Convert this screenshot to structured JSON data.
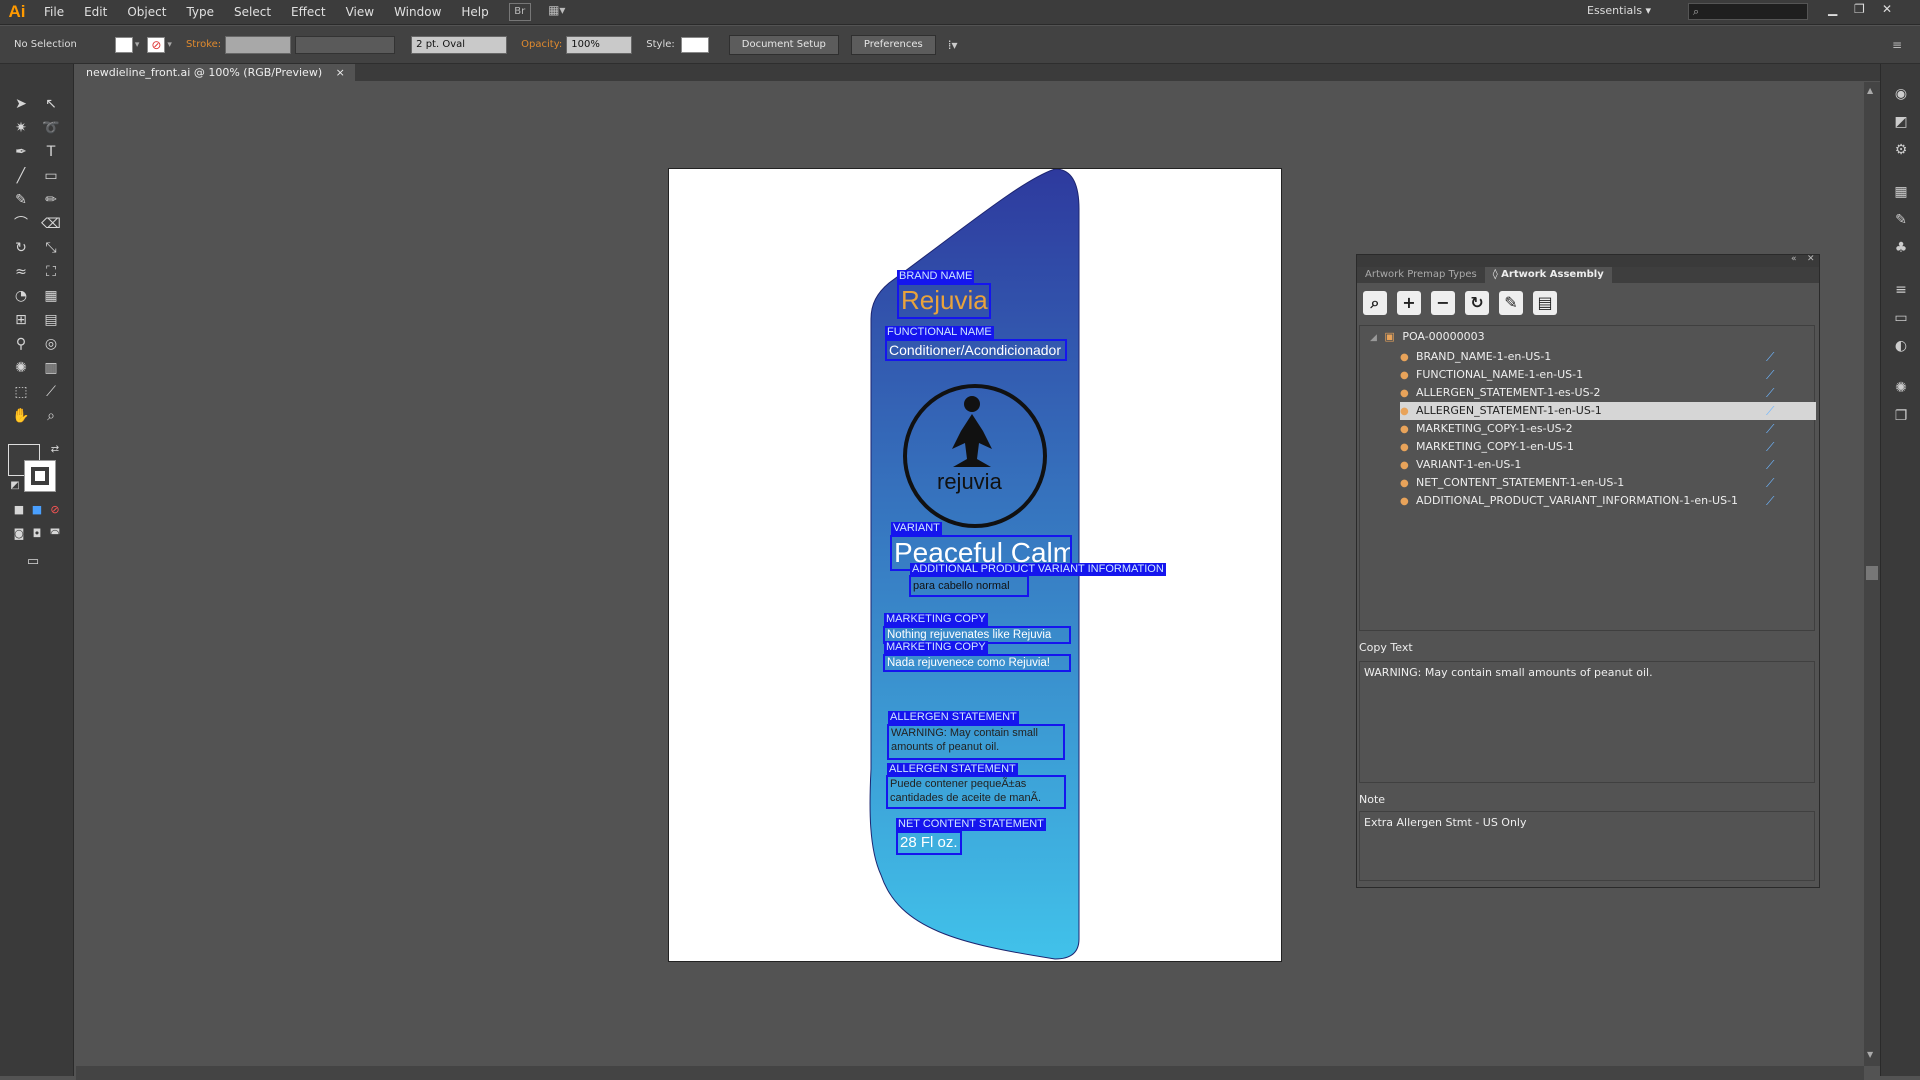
{
  "app": {
    "logo": "Ai"
  },
  "menu": [
    "File",
    "Edit",
    "Object",
    "Type",
    "Select",
    "Effect",
    "View",
    "Window",
    "Help"
  ],
  "menu_extra": {
    "bridge": "Br",
    "arrange": "▦▾"
  },
  "workspace": "Essentials",
  "search_placeholder": "",
  "control": {
    "selection": "No Selection",
    "stroke_label": "Stroke:",
    "brush": "2 pt. Oval",
    "opacity_label": "Opacity:",
    "opacity_value": "100%",
    "style_label": "Style:",
    "doc_setup": "Document Setup",
    "preferences": "Preferences"
  },
  "document_tab": {
    "title": "newdieline_front.ai @ 100% (RGB/Preview)",
    "close": "×"
  },
  "artwork": {
    "brand_tag": "BRAND NAME",
    "brand": "Rejuvia",
    "functional_tag": "FUNCTIONAL NAME",
    "functional": "Conditioner/Acondicionador",
    "logo_text": "rejuvia",
    "variant_tag": "VARIANT",
    "variant": "Peaceful Calm",
    "apvi_tag": "ADDITIONAL PRODUCT VARIANT INFORMATION",
    "apvi": "para cabello normal",
    "mc1_tag": "MARKETING COPY",
    "mc1": "Nothing rejuvenates like Rejuvia",
    "mc2_tag": "MARKETING COPY",
    "mc2": "Nada rejuvenece como Rejuvia!",
    "al1_tag": "ALLERGEN STATEMENT",
    "al1_l1": "WARNING: May contain small",
    "al1_l2": "amounts of peanut oil.",
    "al2_tag": "ALLERGEN STATEMENT",
    "al2_l1": "Puede contener pequeÃ±as",
    "al2_l2": "cantidades de aceite de manÃ.",
    "net_tag": "NET CONTENT STATEMENT",
    "net": "28 Fl oz."
  },
  "panel": {
    "tab1": "Artwork Premap Types",
    "tab2": "◊ Artwork Assembly",
    "root": "POA-00000003",
    "items": [
      "BRAND_NAME-1-en-US-1",
      "FUNCTIONAL_NAME-1-en-US-1",
      "ALLERGEN_STATEMENT-1-es-US-2",
      "ALLERGEN_STATEMENT-1-en-US-1",
      "MARKETING_COPY-1-es-US-2",
      "MARKETING_COPY-1-en-US-1",
      "VARIANT-1-en-US-1",
      "NET_CONTENT_STATEMENT-1-en-US-1",
      "ADDITIONAL_PRODUCT_VARIANT_INFORMATION-1-en-US-1"
    ],
    "selected_index": 3,
    "copy_text_label": "Copy Text",
    "copy_text": "WARNING: May contain small amounts of peanut oil.",
    "note_label": "Note",
    "note": "Extra Allergen Stmt - US Only"
  },
  "colors": {
    "accent": "#1515ee",
    "bottle_top": "#2e3a9e",
    "bottle_bottom": "#41c2ea",
    "brand_text": "#e9a33c"
  }
}
